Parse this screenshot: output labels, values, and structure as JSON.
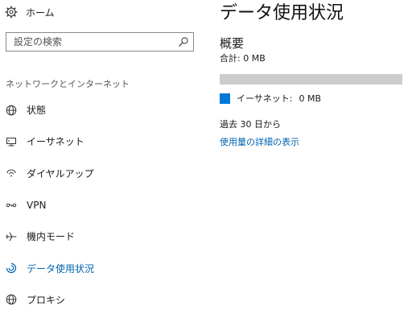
{
  "sidebar": {
    "home": {
      "label": "ホーム",
      "icon": "gear-icon"
    },
    "search": {
      "placeholder": "設定の検索",
      "value": ""
    },
    "section_header": "ネットワークとインターネット",
    "items": [
      {
        "label": "状態",
        "icon": "globe-icon",
        "active": false
      },
      {
        "label": "イーサネット",
        "icon": "ethernet-icon",
        "active": false
      },
      {
        "label": "ダイヤルアップ",
        "icon": "dialup-icon",
        "active": false
      },
      {
        "label": "VPN",
        "icon": "vpn-icon",
        "active": false
      },
      {
        "label": "機内モード",
        "icon": "airplane-icon",
        "active": false
      },
      {
        "label": "データ使用状況",
        "icon": "data-usage-icon",
        "active": true
      },
      {
        "label": "プロキシ",
        "icon": "globe-icon",
        "active": false
      }
    ]
  },
  "main": {
    "title": "データ使用状況",
    "overview_heading": "概要",
    "total": "合計: 0 MB",
    "usage_fraction": 0,
    "legend": {
      "label": "イーサネット:",
      "value": "0 MB"
    },
    "period": "過去 30 日から",
    "details_link": "使用量の詳細の表示"
  },
  "colors": {
    "accent": "#0078d7",
    "link": "#0063b1",
    "bar_track": "#cccccc"
  }
}
